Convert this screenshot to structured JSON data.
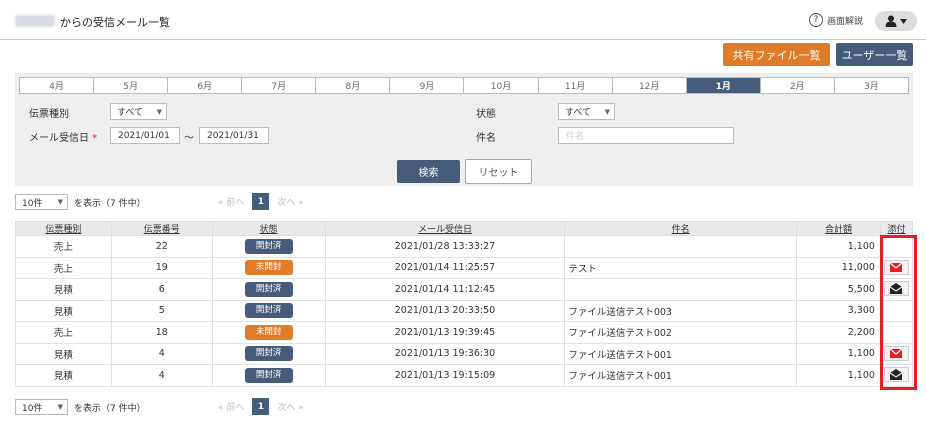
{
  "header": {
    "title": "からの受信メール一覧",
    "help_label": "画面解説",
    "help_icon": "question-circle-icon",
    "user_icon": "user-icon"
  },
  "actions": {
    "shared_files": "共有ファイル一覧",
    "user_list": "ユーザー一覧"
  },
  "months": [
    "4月",
    "5月",
    "6月",
    "7月",
    "8月",
    "9月",
    "10月",
    "11月",
    "12月",
    "1月",
    "2月",
    "3月"
  ],
  "active_month": "1月",
  "filters": {
    "slip_type_label": "伝票種別",
    "slip_type_value": "すべて",
    "received_label": "メール受信日",
    "required_mark": "*",
    "date_from": "2021/01/01",
    "tilde": "～",
    "date_to": "2021/01/31",
    "status_label": "状態",
    "status_value": "すべて",
    "subject_label": "件名",
    "subject_placeholder": "件名",
    "search": "検索",
    "reset": "リセット"
  },
  "pagination": {
    "per_page": "10件",
    "summary": "を表示（7 件中）",
    "prev": "« 前へ",
    "current": "1",
    "next": "次へ »"
  },
  "table": {
    "headers": [
      "伝票種別",
      "伝票番号",
      "状態",
      "メール受信日",
      "件名",
      "合計額",
      "添付"
    ],
    "rows": [
      {
        "type": "売上",
        "number": "22",
        "status": "開封済",
        "status_kind": "opened",
        "date": "2021/01/28 13:33:27",
        "subject": "",
        "total": "1,100",
        "attach": ""
      },
      {
        "type": "売上",
        "number": "19",
        "status": "未開封",
        "status_kind": "unopened",
        "date": "2021/01/14 11:25:57",
        "subject": "テスト",
        "total": "11,000",
        "attach": "mail-closed-icon"
      },
      {
        "type": "見積",
        "number": "6",
        "status": "開封済",
        "status_kind": "opened",
        "date": "2021/01/14 11:12:45",
        "subject": "",
        "total": "5,500",
        "attach": "mail-open-icon"
      },
      {
        "type": "見積",
        "number": "5",
        "status": "開封済",
        "status_kind": "opened",
        "date": "2021/01/13 20:33:50",
        "subject": "ファイル送信テスト003",
        "total": "3,300",
        "attach": ""
      },
      {
        "type": "売上",
        "number": "18",
        "status": "未開封",
        "status_kind": "unopened",
        "date": "2021/01/13 19:39:45",
        "subject": "ファイル送信テスト002",
        "total": "2,200",
        "attach": ""
      },
      {
        "type": "見積",
        "number": "4",
        "status": "開封済",
        "status_kind": "opened",
        "date": "2021/01/13 19:36:30",
        "subject": "ファイル送信テスト001",
        "total": "1,100",
        "attach": "mail-closed-icon"
      },
      {
        "type": "見積",
        "number": "4",
        "status": "開封済",
        "status_kind": "opened",
        "date": "2021/01/13 19:15:09",
        "subject": "ファイル送信テスト001",
        "total": "1,100",
        "attach": "mail-open-icon"
      }
    ]
  },
  "colors": {
    "navy": "#455d7a",
    "orange": "#e07b2a",
    "link": "#2a7ab8",
    "highlight": "#e31e24"
  }
}
